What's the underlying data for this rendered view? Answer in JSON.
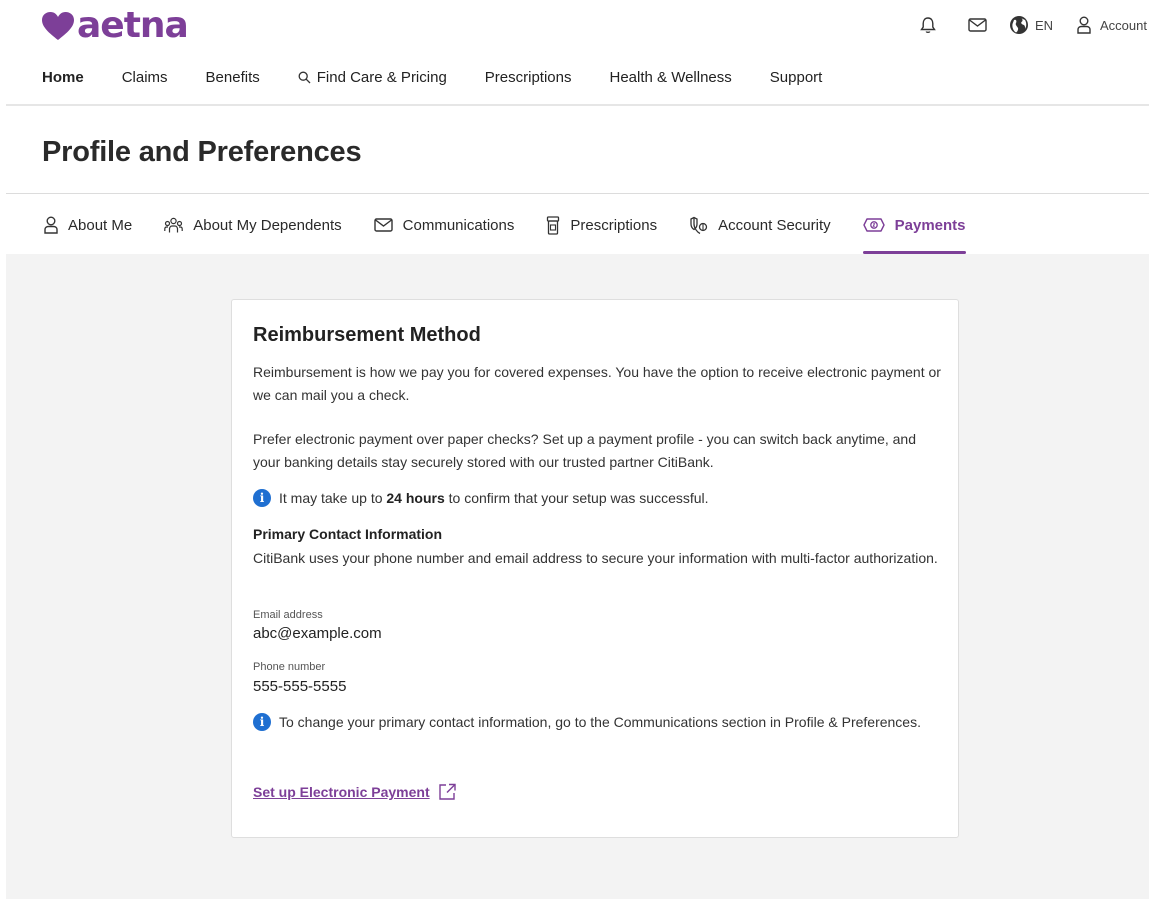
{
  "brand": {
    "name": "aetna",
    "color": "#7d3f98"
  },
  "utility": {
    "language": "EN",
    "account_label": "Account"
  },
  "nav": {
    "items": [
      {
        "label": "Home",
        "active": true
      },
      {
        "label": "Claims"
      },
      {
        "label": "Benefits"
      },
      {
        "label": "Find Care & Pricing",
        "icon": "search-icon"
      },
      {
        "label": "Prescriptions"
      },
      {
        "label": "Health & Wellness"
      },
      {
        "label": "Support"
      }
    ]
  },
  "page": {
    "title": "Profile and Preferences"
  },
  "tabs": [
    {
      "label": "About Me",
      "icon": "person-icon"
    },
    {
      "label": "About My Dependents",
      "icon": "people-icon"
    },
    {
      "label": "Communications",
      "icon": "mail-icon"
    },
    {
      "label": "Prescriptions",
      "icon": "pill-bottle-icon"
    },
    {
      "label": "Account Security",
      "icon": "shield-icon"
    },
    {
      "label": "Payments",
      "icon": "payment-icon",
      "active": true
    }
  ],
  "card": {
    "title": "Reimbursement Method",
    "para1": "Reimbursement is how we pay you for covered expenses. You have the option to receive electronic payment or we can mail you a check.",
    "para2": "Prefer electronic payment over paper checks?  Set up a payment profile - you can switch back anytime, and your banking details stay securely stored with our trusted partner CitiBank.",
    "note1": {
      "before": "It may take up to ",
      "bold": "24 hours",
      "after": " to confirm that your setup was successful."
    },
    "contact_heading": "Primary Contact Information",
    "contact_desc": "CitiBank uses your phone number and email address to secure your information with multi-factor authorization.",
    "email_label": "Email address",
    "email_value": "abc@example.com",
    "phone_label": "Phone number",
    "phone_value": "555-555-5555",
    "note2": "To change your primary contact information, go to the Communications section in Profile & Preferences.",
    "link_label": "Set up Electronic Payment"
  },
  "colors": {
    "accent": "#7d3f98",
    "info": "#1f6fd1",
    "background": "#f3f3f3"
  }
}
